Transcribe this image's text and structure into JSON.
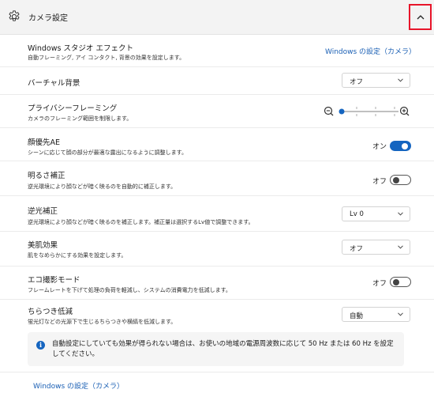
{
  "header": {
    "title": "カメラ設定"
  },
  "rows": [
    {
      "title": "Windows スタジオ エフェクト",
      "desc": "自動フレーミング, アイ コンタクト, 背景の効果を設定します。",
      "link": "Windows の設定（カメラ）"
    },
    {
      "title": "バーチャル背景",
      "dropdown": "オフ"
    },
    {
      "title": "プライバシーフレーミング",
      "desc": "カメラのフレーミング範囲を制限します。",
      "slider_value": 0.0
    },
    {
      "title": "顔優先AE",
      "desc": "シーンに応じて顔の部分が最適な露出になるように調整します。",
      "toggle_label": "オン",
      "toggle_on": true
    },
    {
      "title": "明るさ補正",
      "desc": "逆光環境により顔などが暗く映るのを自動的に補正します。",
      "toggle_label": "オフ",
      "toggle_on": false
    },
    {
      "title": "逆光補正",
      "desc": "逆光環境により顔などが暗く映るのを補正します。補正量は選択するLv値で調整できます。",
      "dropdown": "Lv 0"
    },
    {
      "title": "美肌効果",
      "desc": "肌をなめらかにする効果を設定します。",
      "dropdown": "オフ"
    },
    {
      "title": "エコ撮影モード",
      "desc": "フレームレートを下げて処理の負荷を軽減し、システムの消費電力を低減します。",
      "toggle_label": "オフ",
      "toggle_on": false
    },
    {
      "title": "ちらつき低減",
      "desc": "蛍光灯などの光源下で生じるちらつきや横縞を低減します。",
      "dropdown": "自動"
    }
  ],
  "info": {
    "icon": "info-icon",
    "text": "自動設定にしていても効果が得られない場合は、お使いの地域の電源周波数に応じて 50 Hz または 60 Hz を設定してください。"
  },
  "footer": {
    "link": "Windows の設定（カメラ）"
  },
  "colors": {
    "accent": "#1565c0",
    "highlight_border": "#e8152a"
  }
}
